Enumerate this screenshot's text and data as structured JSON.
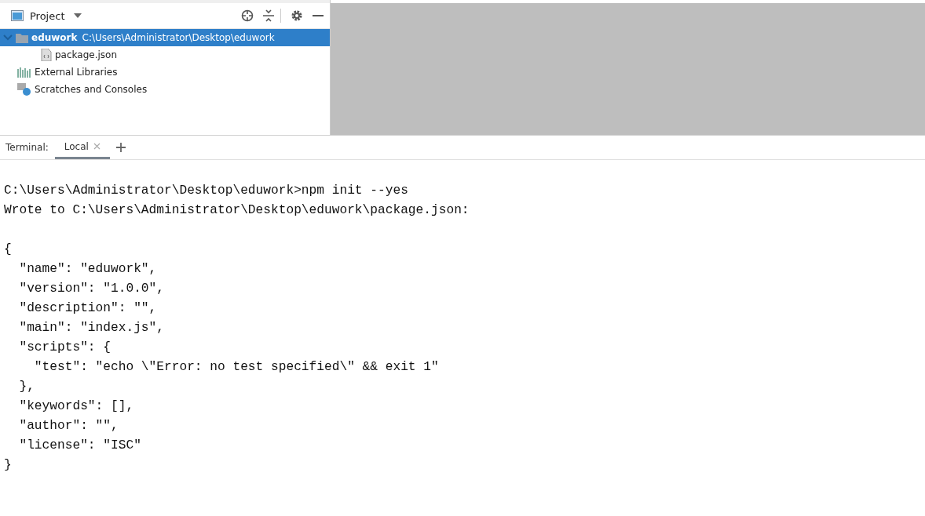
{
  "project_panel": {
    "title": "Project",
    "tree": [
      {
        "label": "eduwork",
        "path": "C:\\Users\\Administrator\\Desktop\\eduwork",
        "kind": "folder",
        "selected": true,
        "expanded": true,
        "children": [
          {
            "label": "package.json",
            "kind": "json",
            "selected": false
          }
        ]
      },
      {
        "label": "External Libraries",
        "kind": "libraries",
        "selected": false
      },
      {
        "label": "Scratches and Consoles",
        "kind": "scratches",
        "selected": false
      }
    ]
  },
  "terminal": {
    "label": "Terminal:",
    "tabs": [
      {
        "label": "Local",
        "selected": true
      }
    ],
    "blocks": [
      [
        "C:\\Users\\Administrator\\Desktop\\eduwork>npm init --yes",
        "Wrote to C:\\Users\\Administrator\\Desktop\\eduwork\\package.json:"
      ],
      [
        "{",
        "  \"name\": \"eduwork\",",
        "  \"version\": \"1.0.0\",",
        "  \"description\": \"\",",
        "  \"main\": \"index.js\",",
        "  \"scripts\": {",
        "    \"test\": \"echo \\\"Error: no test specified\\\" && exit 1\"",
        "  },",
        "  \"keywords\": [],",
        "  \"author\": \"\",",
        "  \"license\": \"ISC\"",
        "}"
      ]
    ]
  }
}
